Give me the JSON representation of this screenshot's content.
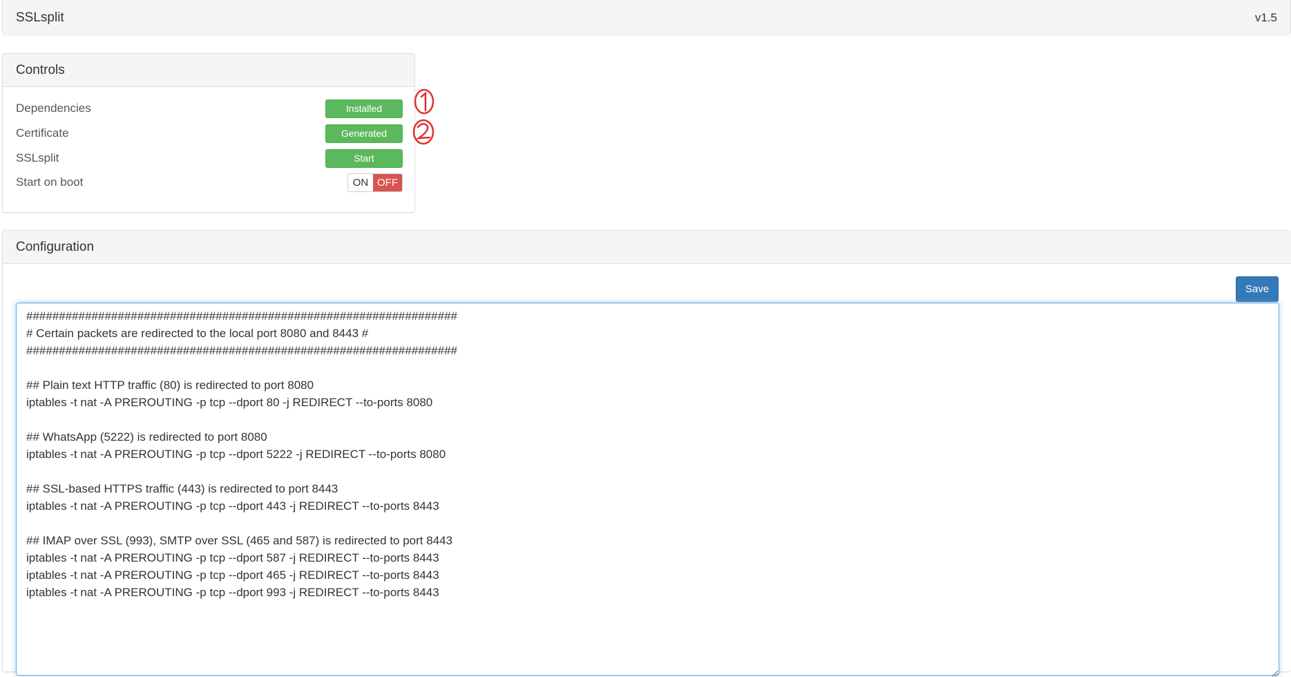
{
  "header": {
    "title": "SSLsplit",
    "version": "v1.5"
  },
  "controls": {
    "title": "Controls",
    "rows": [
      {
        "label": "Dependencies",
        "button": "Installed"
      },
      {
        "label": "Certificate",
        "button": "Generated"
      },
      {
        "label": "SSLsplit",
        "button": "Start"
      },
      {
        "label": "Start on boot"
      }
    ],
    "toggle": {
      "on": "ON",
      "off": "OFF",
      "state": "off"
    }
  },
  "annotations": [
    "1",
    "2"
  ],
  "configuration": {
    "title": "Configuration",
    "save_label": "Save",
    "text": "##################################################################\n# Certain packets are redirected to the local port 8080 and 8443 #\n##################################################################\n\n## Plain text HTTP traffic (80) is redirected to port 8080\niptables -t nat -A PREROUTING -p tcp --dport 80 -j REDIRECT --to-ports 8080\n\n## WhatsApp (5222) is redirected to port 8080\niptables -t nat -A PREROUTING -p tcp --dport 5222 -j REDIRECT --to-ports 8080\n\n## SSL-based HTTPS traffic (443) is redirected to port 8443\niptables -t nat -A PREROUTING -p tcp --dport 443 -j REDIRECT --to-ports 8443\n\n## IMAP over SSL (993), SMTP over SSL (465 and 587) is redirected to port 8443\niptables -t nat -A PREROUTING -p tcp --dport 587 -j REDIRECT --to-ports 8443\niptables -t nat -A PREROUTING -p tcp --dport 465 -j REDIRECT --to-ports 8443\niptables -t nat -A PREROUTING -p tcp --dport 993 -j REDIRECT --to-ports 8443"
  },
  "colors": {
    "success": "#5cb85c",
    "danger": "#d9534f",
    "primary": "#337ab7",
    "annotation": "#e03030"
  }
}
